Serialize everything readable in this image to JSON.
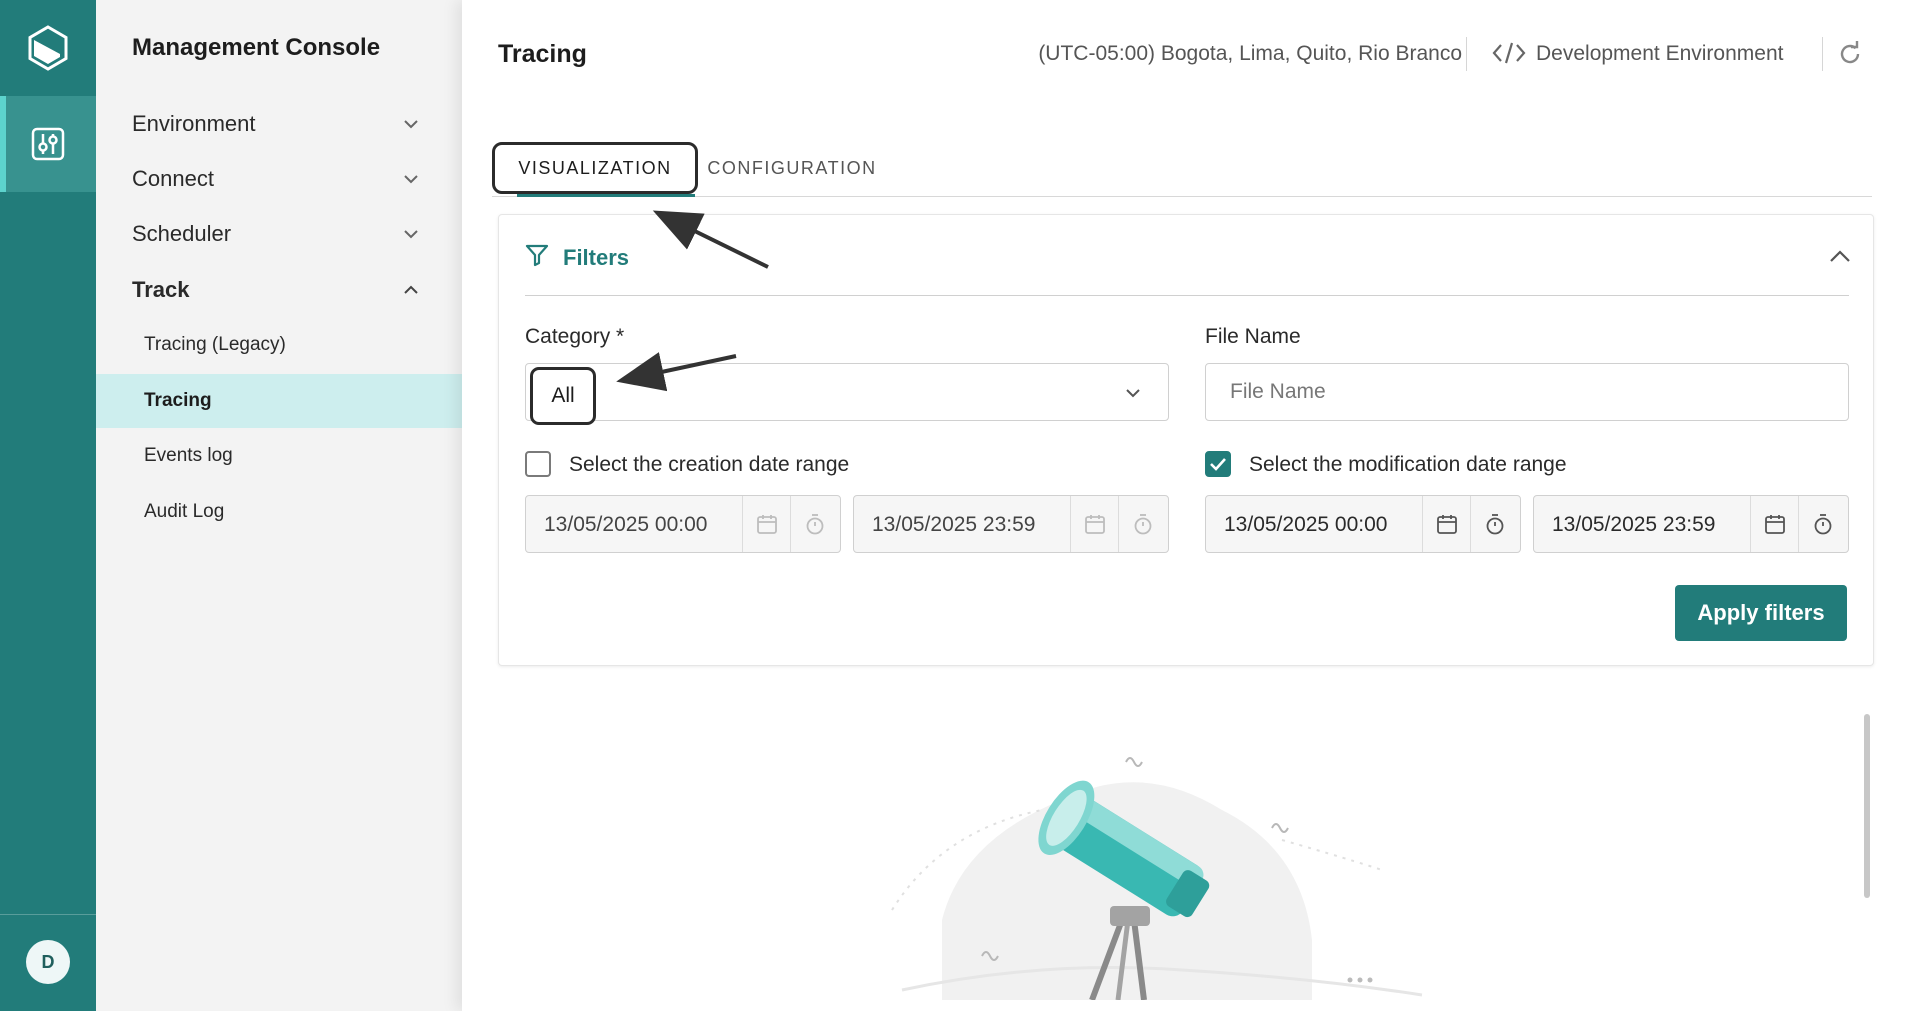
{
  "app": {
    "title": "Management Console",
    "avatar_initial": "D"
  },
  "sidebar": {
    "sections": [
      {
        "label": "Environment",
        "expanded": false
      },
      {
        "label": "Connect",
        "expanded": false
      },
      {
        "label": "Scheduler",
        "expanded": false
      },
      {
        "label": "Track",
        "expanded": true
      }
    ],
    "track_items": [
      {
        "label": "Tracing (Legacy)",
        "selected": false
      },
      {
        "label": "Tracing",
        "selected": true
      },
      {
        "label": "Events log",
        "selected": false
      },
      {
        "label": "Audit Log",
        "selected": false
      }
    ]
  },
  "header": {
    "title": "Tracing",
    "timezone": "(UTC-05:00) Bogota, Lima, Quito, Rio Branco",
    "environment": "Development Environment"
  },
  "tabs": [
    {
      "label": "VISUALIZATION",
      "active": true
    },
    {
      "label": "CONFIGURATION",
      "active": false
    }
  ],
  "filters": {
    "title": "Filters",
    "category": {
      "label": "Category *",
      "value": "All"
    },
    "file_name": {
      "label": "File Name",
      "placeholder": "File Name",
      "value": ""
    },
    "creation_range": {
      "label": "Select the creation date range",
      "checked": false,
      "start": "13/05/2025 00:00",
      "end": "13/05/2025 23:59"
    },
    "modification_range": {
      "label": "Select the modification date range",
      "checked": true,
      "start": "13/05/2025 00:00",
      "end": "13/05/2025 23:59"
    },
    "apply_label": "Apply filters"
  },
  "icons": {
    "logo": "logo-icon",
    "settings_sliders": "sliders-icon",
    "code": "code-icon",
    "refresh": "refresh-icon",
    "funnel": "filter-icon",
    "calendar": "calendar-icon",
    "stopwatch": "stopwatch-icon"
  },
  "colors": {
    "brand": "#227c7a",
    "selected_nav": "#cdeeee",
    "rail_active": "#38928f"
  }
}
